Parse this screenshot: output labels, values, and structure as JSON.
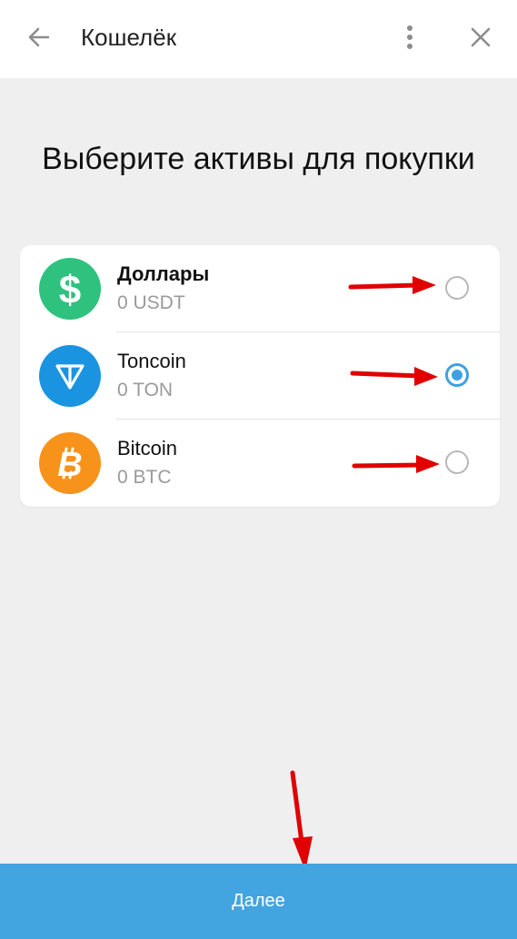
{
  "header": {
    "title": "Кошелёк",
    "back_icon": "arrow-left-icon",
    "menu_icon": "more-vertical-icon",
    "close_icon": "close-icon"
  },
  "page": {
    "heading": "Выберите активы для покупки"
  },
  "assets": [
    {
      "name": "Доллары",
      "balance": "0 USDT",
      "icon": "dollar-icon",
      "color": "#2ec27e",
      "selected": false
    },
    {
      "name": "Toncoin",
      "balance": "0 TON",
      "icon": "ton-icon",
      "color": "#1a94e0",
      "selected": true
    },
    {
      "name": "Bitcoin",
      "balance": "0 BTC",
      "icon": "bitcoin-icon",
      "color": "#f7931a",
      "selected": false
    }
  ],
  "footer": {
    "next_label": "Далее",
    "color": "#42a5df"
  },
  "annotations": {
    "arrow_color": "#e00000"
  }
}
